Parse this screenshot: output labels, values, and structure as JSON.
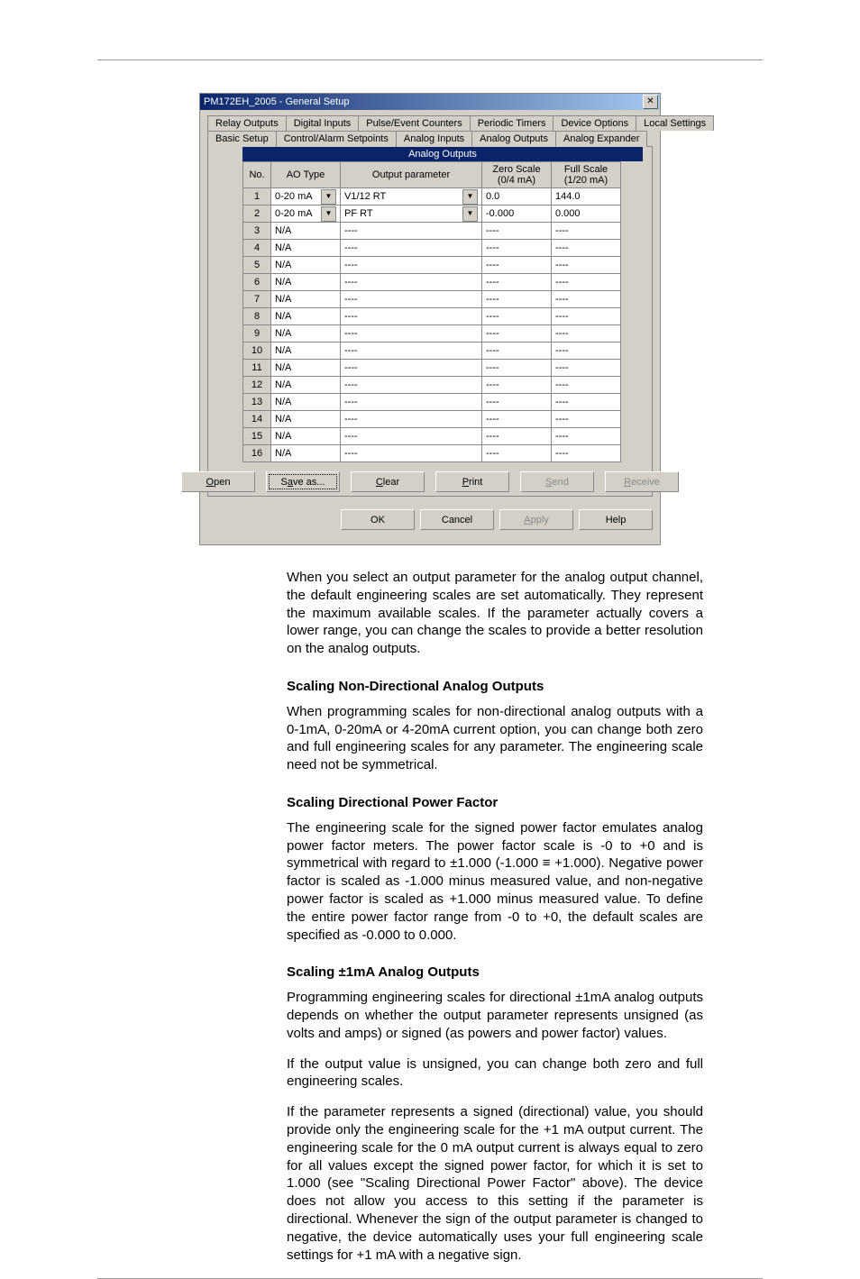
{
  "dialog": {
    "title": "PM172EH_2005 - General Setup",
    "close_glyph": "✕",
    "tabs_row1": [
      "Relay Outputs",
      "Digital Inputs",
      "Pulse/Event Counters",
      "Periodic Timers",
      "Device Options",
      "Local Settings"
    ],
    "tabs_row2": [
      "Basic Setup",
      "Control/Alarm Setpoints",
      "Analog Inputs",
      "Analog Outputs",
      "Analog Expander"
    ],
    "active_tab": "Analog Outputs",
    "table": {
      "title": "Analog Outputs",
      "headers": [
        "No.",
        "AO Type",
        "Output parameter",
        "Zero Scale (0/4 mA)",
        "Full Scale (1/20 mA)"
      ],
      "rows": [
        {
          "no": "1",
          "type": "0-20 mA",
          "type_dd": true,
          "param": "V1/12 RT",
          "param_dd": true,
          "zero": "0.0",
          "full": "144.0"
        },
        {
          "no": "2",
          "type": "0-20 mA",
          "type_dd": true,
          "param": "PF RT",
          "param_dd": true,
          "zero": "-0.000",
          "full": "0.000"
        },
        {
          "no": "3",
          "type": "N/A",
          "param": "----",
          "zero": "----",
          "full": "----"
        },
        {
          "no": "4",
          "type": "N/A",
          "param": "----",
          "zero": "----",
          "full": "----"
        },
        {
          "no": "5",
          "type": "N/A",
          "param": "----",
          "zero": "----",
          "full": "----"
        },
        {
          "no": "6",
          "type": "N/A",
          "param": "----",
          "zero": "----",
          "full": "----"
        },
        {
          "no": "7",
          "type": "N/A",
          "param": "----",
          "zero": "----",
          "full": "----"
        },
        {
          "no": "8",
          "type": "N/A",
          "param": "----",
          "zero": "----",
          "full": "----"
        },
        {
          "no": "9",
          "type": "N/A",
          "param": "----",
          "zero": "----",
          "full": "----"
        },
        {
          "no": "10",
          "type": "N/A",
          "param": "----",
          "zero": "----",
          "full": "----"
        },
        {
          "no": "11",
          "type": "N/A",
          "param": "----",
          "zero": "----",
          "full": "----"
        },
        {
          "no": "12",
          "type": "N/A",
          "param": "----",
          "zero": "----",
          "full": "----"
        },
        {
          "no": "13",
          "type": "N/A",
          "param": "----",
          "zero": "----",
          "full": "----"
        },
        {
          "no": "14",
          "type": "N/A",
          "param": "----",
          "zero": "----",
          "full": "----"
        },
        {
          "no": "15",
          "type": "N/A",
          "param": "----",
          "zero": "----",
          "full": "----"
        },
        {
          "no": "16",
          "type": "N/A",
          "param": "----",
          "zero": "----",
          "full": "----"
        }
      ]
    },
    "inner_buttons": {
      "open": "Open",
      "saveas": "Save as...",
      "clear": "Clear",
      "print": "Print",
      "send": "Send",
      "receive": "Receive"
    },
    "outer_buttons": {
      "ok": "OK",
      "cancel": "Cancel",
      "apply": "Apply",
      "help": "Help"
    }
  },
  "body": {
    "p1": "When you select an output parameter for the analog output channel, the default engineering scales are set automatically. They represent the maximum available scales. If the parameter actually covers a lower range, you can change the scales to provide a better resolution on the analog outputs.",
    "h1": "Scaling Non-Directional Analog Outputs",
    "p2": "When programming scales for non-directional analog outputs with a 0-1mA, 0-20mA or 4-20mA current option, you can change both zero and full engineering scales for any parameter. The engineering scale need not be symmetrical.",
    "h2": "Scaling Directional Power Factor",
    "p3": "The engineering scale for the signed power factor emulates analog power factor meters. The power factor scale is -0 to +0 and is symmetrical with regard to ±1.000 (-1.000 ≡ +1.000). Negative power factor is scaled as -1.000 minus measured value, and non-negative power factor is scaled as +1.000 minus measured value. To define the entire power factor range from -0 to +0, the default scales are specified as -0.000 to 0.000.",
    "h3": "Scaling ±1mA Analog Outputs",
    "p4": "Programming engineering scales for directional ±1mA analog outputs depends on whether the output parameter represents unsigned (as volts and amps) or signed (as powers and power factor) values.",
    "p5": "If the output value is unsigned, you can change both zero and full engineering scales.",
    "p6": "If the parameter represents a signed (directional) value, you should provide only the engineering scale for the +1 mA output current. The engineering scale for the 0 mA output current is always equal to zero for all values except the signed power factor, for which it is set to 1.000 (see \"Scaling Directional Power Factor\" above). The device does not allow you access to this setting if the parameter is directional. Whenever the sign of the output parameter is changed to negative, the device automatically uses your full engineering scale settings for +1 mA with a negative sign."
  }
}
